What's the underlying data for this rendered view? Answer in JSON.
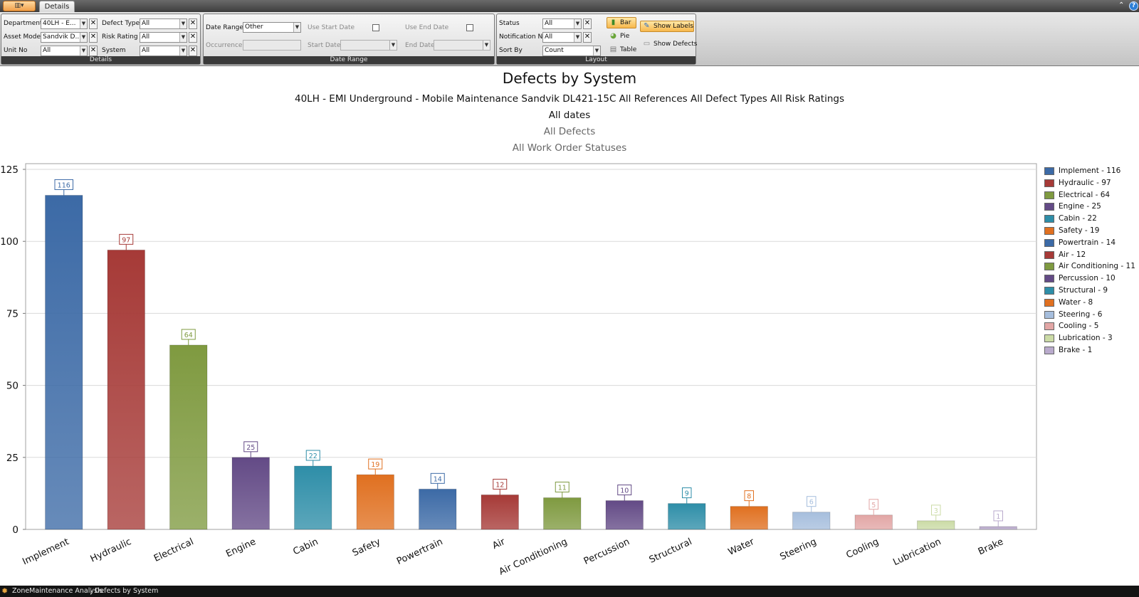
{
  "header": {
    "tab_label": "Details",
    "app_menu_label": "▥▾"
  },
  "ribbon": {
    "details": {
      "title": "Details",
      "department": {
        "label": "Department",
        "value": "40LH - E..."
      },
      "asset_model": {
        "label": "Asset Model",
        "value": "Sandvik D..."
      },
      "unit_no": {
        "label": "Unit No",
        "value": "All"
      },
      "defect_type": {
        "label": "Defect Type",
        "value": "All"
      },
      "risk_rating": {
        "label": "Risk Rating",
        "value": "All"
      },
      "system": {
        "label": "System",
        "value": "All"
      }
    },
    "date_range": {
      "title": "Date Range",
      "date_range": {
        "label": "Date Range",
        "value": "Other"
      },
      "occurrences": {
        "label": "Occurrences",
        "value": ""
      },
      "use_start_date": {
        "label": "Use Start Date"
      },
      "start_date": {
        "label": "Start Date",
        "value": ""
      },
      "use_end_date": {
        "label": "Use End Date"
      },
      "end_date": {
        "label": "End Date",
        "value": ""
      }
    },
    "layout": {
      "title": "Layout",
      "status": {
        "label": "Status",
        "value": "All"
      },
      "notification_no": {
        "label": "Notification No",
        "value": "All"
      },
      "sort_by": {
        "label": "Sort By",
        "value": "Count"
      },
      "bar": "Bar",
      "pie": "Pie",
      "table": "Table",
      "show_labels": "Show Labels",
      "show_defects": "Show Defects",
      "active_view": "Bar",
      "show_labels_active": true
    }
  },
  "chart_data": {
    "type": "bar",
    "title": "Defects by System",
    "subtitles": [
      "40LH - EMI Underground - Mobile Maintenance Sandvik DL421-15C All References All Defect Types All Risk Ratings",
      "All dates",
      "All Defects",
      "All Work Order Statuses"
    ],
    "categories": [
      "Implement",
      "Hydraulic",
      "Electrical",
      "Engine",
      "Cabin",
      "Safety",
      "Powertrain",
      "Air",
      "Air Conditioning",
      "Percussion",
      "Structural",
      "Water",
      "Steering",
      "Cooling",
      "Lubrication",
      "Brake"
    ],
    "values": [
      116,
      97,
      64,
      25,
      22,
      19,
      14,
      12,
      11,
      10,
      9,
      8,
      6,
      5,
      3,
      1
    ],
    "colors": [
      "#3c6aa6",
      "#a63a37",
      "#7f9a40",
      "#634a86",
      "#2e8ea8",
      "#e07020",
      "#3c6aa6",
      "#a63a37",
      "#7f9a40",
      "#634a86",
      "#2e8ea8",
      "#e07020",
      "#a6bedd",
      "#e2a6a5",
      "#cbdba6",
      "#b9aacc"
    ],
    "legend": [
      "Implement - 116",
      "Hydraulic - 97",
      "Electrical - 64",
      "Engine - 25",
      "Cabin - 22",
      "Safety - 19",
      "Powertrain - 14",
      "Air - 12",
      "Air Conditioning - 11",
      "Percussion - 10",
      "Structural - 9",
      "Water - 8",
      "Steering - 6",
      "Cooling - 5",
      "Lubrication - 3",
      "Brake - 1"
    ],
    "legend_position": "right",
    "ylim": [
      0,
      125
    ],
    "yticks": [
      0,
      25,
      50,
      75,
      100,
      125
    ],
    "grid": true,
    "data_labels": true
  },
  "statusbar": {
    "app": "ZoneMaintenance Analysis",
    "view": "Defects by System"
  }
}
